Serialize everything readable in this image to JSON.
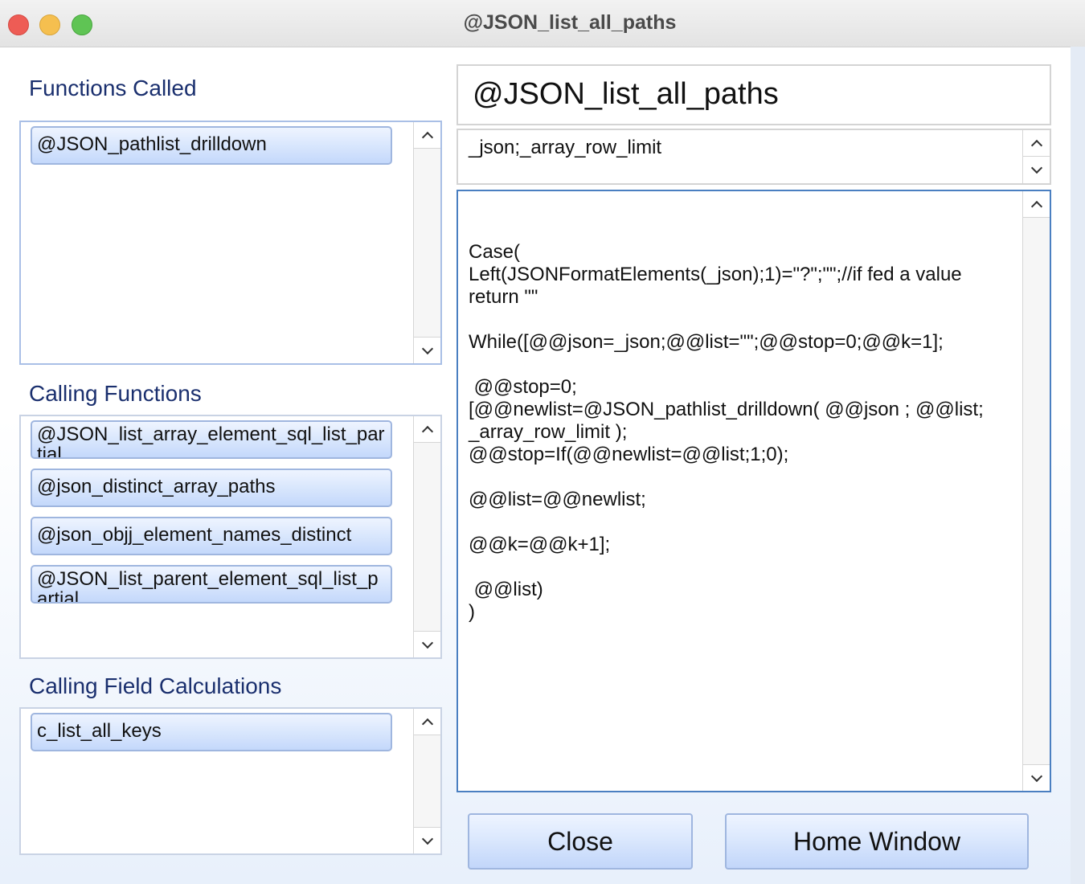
{
  "window": {
    "title": "@JSON_list_all_paths"
  },
  "functions_called": {
    "label": "Functions Called",
    "items": [
      "@JSON_pathlist_drilldown"
    ]
  },
  "calling_functions": {
    "label": "Calling Functions",
    "items": [
      "@JSON_list_array_element_sql_list_partial",
      "@json_distinct_array_paths",
      "@json_objj_element_names_distinct",
      "@JSON_list_parent_element_sql_list_partial"
    ]
  },
  "calling_field_calculations": {
    "label": "Calling Field Calculations",
    "items": [
      "c_list_all_keys"
    ]
  },
  "function_name": "@JSON_list_all_paths",
  "parameters": "_json;_array_row_limit",
  "code": {
    "l1": "Case(",
    "l2": "Left(JSONFormatElements(_json);1)=\"?\";\"\";//if fed a value",
    "l3": "return \"\"",
    "l4": "While([@@json=_json;@@list=\"\";@@stop=0;@@k=1];",
    "l5": " @@stop=0;",
    "l6": "[@@newlist=@JSON_pathlist_drilldown( @@json ; @@list;",
    "l7": "_array_row_limit );",
    "l8": "@@stop=If(@@newlist=@@list;1;0);",
    "l9": "@@list=@@newlist;",
    "l10": "@@k=@@k+1];",
    "l11": " @@list)",
    "l12": ")"
  },
  "buttons": {
    "close": "Close",
    "home": "Home Window"
  }
}
